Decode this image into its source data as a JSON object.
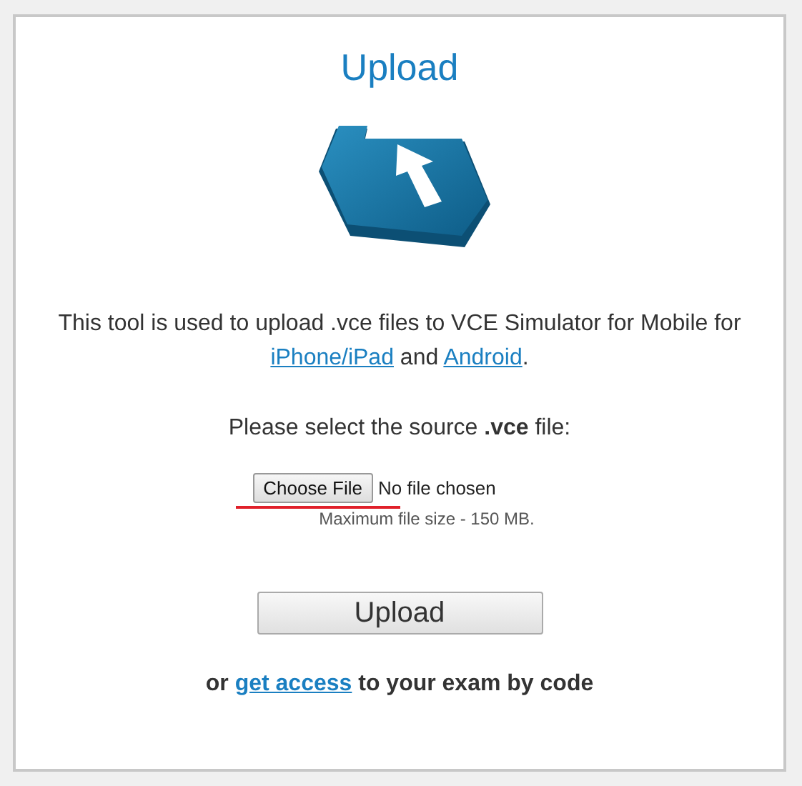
{
  "title": "Upload",
  "description": [
    {
      "kind": "text",
      "text": "This tool is used to upload .vce files to VCE Simulator for Mobile for "
    },
    {
      "kind": "link",
      "text": "iPhone/iPad"
    },
    {
      "kind": "text",
      "text": " and "
    },
    {
      "kind": "link",
      "text": "Android"
    },
    {
      "kind": "text",
      "text": "."
    }
  ],
  "select_prompt": "Please select the source **.vce** file:",
  "file_input": {
    "button": "Choose File",
    "status": "No file chosen",
    "hint": "Maximum file size - 150 MB."
  },
  "upload_button": "Upload",
  "footer": [
    {
      "kind": "text",
      "text": "or "
    },
    {
      "kind": "link",
      "text": "get access"
    },
    {
      "kind": "text",
      "text": " to your exam by code"
    }
  ]
}
